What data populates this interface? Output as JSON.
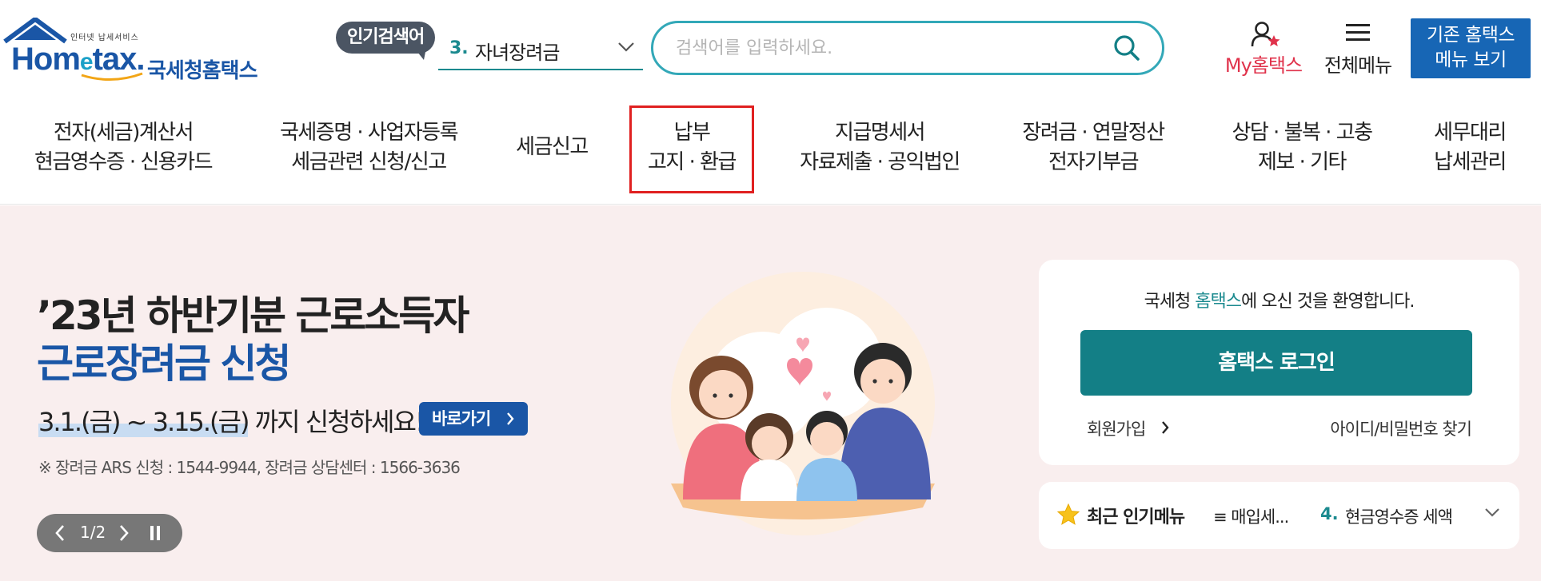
{
  "header": {
    "logo": {
      "word_pre": "Hom",
      "word_e": "e",
      "word_post": "tax.",
      "tagline": "인터넷 납세서비스",
      "title_kr": "국세청홈택스"
    },
    "popular_badge": "인기검색어",
    "popular_select": {
      "rank": "3.",
      "text": "자녀장려금"
    },
    "search": {
      "placeholder": "검색어를 입력하세요.",
      "value": ""
    },
    "my_hometax": "My홈택스",
    "all_menu": "전체메뉴",
    "old_menu": {
      "line1": "기존 홈택스",
      "line2": "메뉴 보기"
    }
  },
  "nav": {
    "items": [
      {
        "line1": "전자(세금)계산서",
        "line2": "현금영수증 · 신용카드"
      },
      {
        "line1": "국세증명 · 사업자등록",
        "line2": "세금관련 신청/신고"
      },
      {
        "line1": "세금신고"
      },
      {
        "line1": "납부",
        "line2": "고지 · 환급"
      },
      {
        "line1": "지급명세서",
        "line2": "자료제출 · 공익법인"
      },
      {
        "line1": "장려금 · 연말정산",
        "line2": "전자기부금"
      },
      {
        "line1": "상담 · 불복 · 고충",
        "line2": "제보 · 기타"
      },
      {
        "line1": "세무대리",
        "line2": "납세관리"
      }
    ]
  },
  "banner": {
    "title_line1": "’23년 하반기분 근로소득자",
    "title_line2": "근로장려금 신청",
    "date_range": "3.1.(금) ~ 3.15.(금)",
    "date_suffix": " 까지 신청하세요!",
    "go_button": "바로가기",
    "note": "※ 장려금 ARS 신청 : 1544-9944, 장려금 상담센터 : 1566-3636",
    "pager": "1/2"
  },
  "login": {
    "welcome_pre": "국세청 ",
    "welcome_brand": "홈택스",
    "welcome_post": "에 오신 것을 환영합니다.",
    "login_button": "홈택스 로그인",
    "join": "회원가입",
    "find": "아이디/비밀번호 찾기"
  },
  "popular_menu": {
    "title": "최근 인기메뉴",
    "item1": "≡ 매입세...",
    "rank2": "4.",
    "item2": "현금영수증 세액"
  },
  "colors": {
    "brand_blue": "#1a56a6",
    "teal": "#137f86",
    "search_border": "#33a8b8",
    "highlight_red": "#e02020",
    "my_hometax_red": "#e0324b",
    "banner_bg": "#f9eeee"
  }
}
